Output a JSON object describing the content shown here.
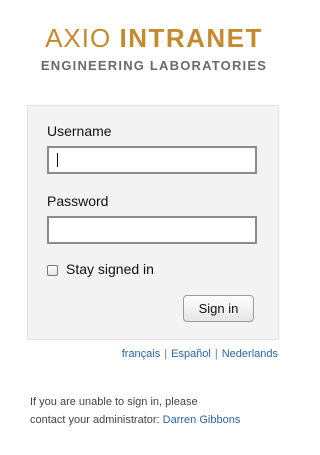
{
  "header": {
    "logo_part1": "AXIO",
    "logo_part2": "INTRANET",
    "subtitle": "ENGINEERING LABORATORIES"
  },
  "colors": {
    "logo_accent": "#c68a2e",
    "link": "#2a64a8"
  },
  "form": {
    "username_label": "Username",
    "username_value": "",
    "password_label": "Password",
    "password_value": "",
    "stay_signed_in_label": "Stay signed in",
    "stay_signed_in_checked": false,
    "sign_in_button": "Sign in"
  },
  "languages": [
    "français",
    "Español",
    "Nederlands"
  ],
  "help": {
    "line1": "If you are unable to sign in, please",
    "line2_prefix": "contact your administrator: ",
    "admin_name": "Darren Gibbons"
  }
}
